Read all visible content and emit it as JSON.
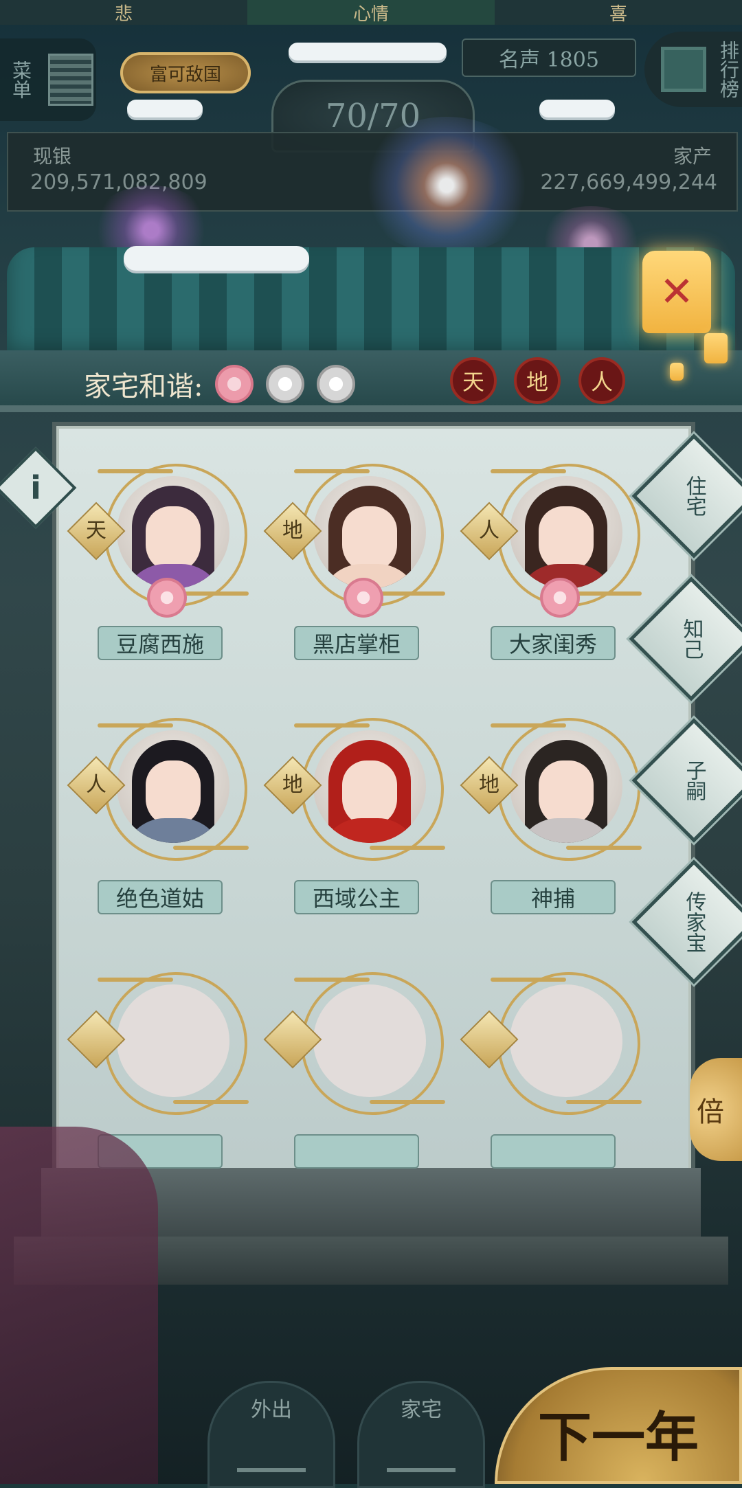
{
  "mood": {
    "left": "悲",
    "center": "心情",
    "right": "喜"
  },
  "side_menu": {
    "label": "菜单"
  },
  "badge": {
    "label": "富可敌国"
  },
  "fame": {
    "label": "名声 1805"
  },
  "ranking": {
    "label": "排行榜"
  },
  "energy": {
    "value": "70/70"
  },
  "money": {
    "cash_label": "现银",
    "cash_value": "209,571,082,809",
    "assets_label": "家产",
    "assets_value": "227,669,499,244"
  },
  "harmony": {
    "label": "家宅和谐:",
    "flowers": [
      "pink",
      "white",
      "white"
    ]
  },
  "tiandiren": [
    "天",
    "地",
    "人"
  ],
  "lantern": {
    "icon": "lantern-icon"
  },
  "info_button": {
    "label": "i"
  },
  "side_tabs": [
    {
      "label": "住宅"
    },
    {
      "label": "知己"
    },
    {
      "label": "子嗣"
    },
    {
      "label": "传家宝"
    }
  ],
  "companions": [
    {
      "name": "豆腐西施",
      "rank": "天",
      "has_blossom": true,
      "hair": "#3c2b3d",
      "robe": "#8d5aa8"
    },
    {
      "name": "黑店掌柜",
      "rank": "地",
      "has_blossom": true,
      "hair": "#4b2d24",
      "robe": "#f1d3c2"
    },
    {
      "name": "大家闺秀",
      "rank": "人",
      "has_blossom": true,
      "hair": "#3a2620",
      "robe": "#9e2a2a"
    },
    {
      "name": "绝色道姑",
      "rank": "人",
      "has_blossom": false,
      "hair": "#1c1a20",
      "robe": "#6e7f9a"
    },
    {
      "name": "西域公主",
      "rank": "地",
      "has_blossom": false,
      "hair": "#b11f1a",
      "robe": "#c0261f"
    },
    {
      "name": "神捕",
      "rank": "地",
      "has_blossom": false,
      "hair": "#2b2522",
      "robe": "#c8c3c3"
    }
  ],
  "empty_slots": 3,
  "double_button": {
    "label": "倍"
  },
  "bottom_nav": {
    "outing": "外出",
    "home": "家宅",
    "next_year": "下一年"
  }
}
